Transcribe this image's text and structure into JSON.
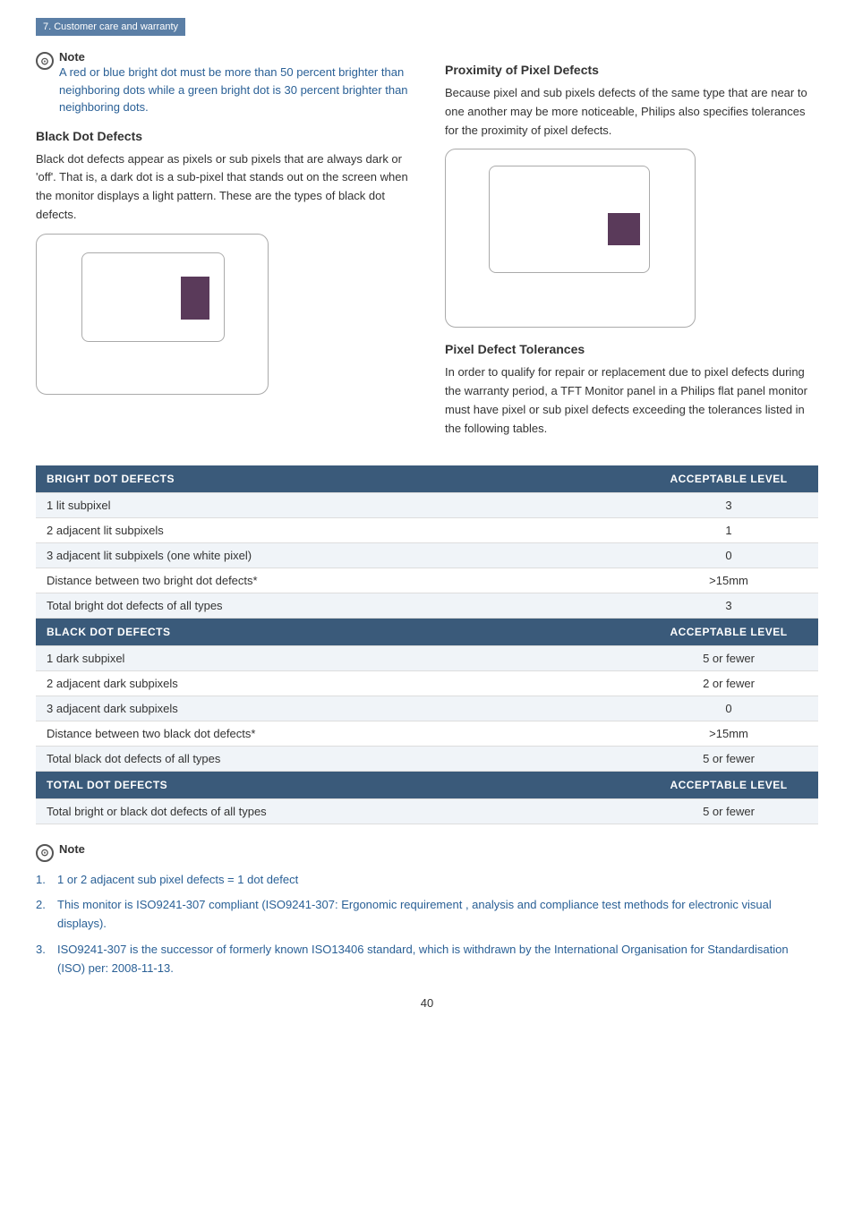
{
  "breadcrumb": {
    "text": "7. Customer care and warranty"
  },
  "note_top": {
    "label": "Note",
    "text": "A red or blue bright dot must be more than 50 percent brighter than neighboring dots while a green bright dot is 30 percent brighter than neighboring dots."
  },
  "black_dot": {
    "heading": "Black Dot Defects",
    "body": "Black dot defects appear as pixels or sub pixels that are always dark or 'off'. That is, a dark dot is a sub-pixel that stands out on the screen when the monitor displays a light pattern. These are the types of black dot defects."
  },
  "proximity": {
    "heading": "Proximity of Pixel Defects",
    "body": "Because pixel and sub pixels defects of the same type that are near to one another may be more noticeable, Philips also specifies tolerances for the proximity of pixel defects."
  },
  "pixel_tolerances": {
    "heading": "Pixel Defect Tolerances",
    "body": "In order to qualify for repair or replacement due to pixel defects during the warranty period, a TFT Monitor panel in a Philips flat panel monitor must have pixel or sub pixel defects exceeding the tolerances listed in the following tables."
  },
  "table": {
    "sections": [
      {
        "header_left": "BRIGHT DOT DEFECTS",
        "header_right": "ACCEPTABLE LEVEL",
        "rows": [
          {
            "left": "1 lit subpixel",
            "right": "3"
          },
          {
            "left": "2 adjacent lit subpixels",
            "right": "1"
          },
          {
            "left": "3 adjacent lit subpixels (one white pixel)",
            "right": "0"
          },
          {
            "left": "Distance between two bright dot defects*",
            "right": ">15mm"
          },
          {
            "left": "Total bright dot defects of all types",
            "right": "3"
          }
        ]
      },
      {
        "header_left": "BLACK DOT DEFECTS",
        "header_right": "ACCEPTABLE LEVEL",
        "rows": [
          {
            "left": "1 dark subpixel",
            "right": "5 or fewer"
          },
          {
            "left": "2 adjacent dark subpixels",
            "right": "2 or fewer"
          },
          {
            "left": "3 adjacent dark subpixels",
            "right": "0"
          },
          {
            "left": "Distance between two black dot defects*",
            "right": ">15mm"
          },
          {
            "left": "Total black dot defects of all types",
            "right": "5 or fewer"
          }
        ]
      },
      {
        "header_left": "TOTAL DOT DEFECTS",
        "header_right": "ACCEPTABLE LEVEL",
        "rows": [
          {
            "left": "Total bright or black dot defects of all types",
            "right": "5 or fewer"
          }
        ]
      }
    ]
  },
  "note_bottom": {
    "label": "Note",
    "items": [
      "1 or 2 adjacent sub pixel defects = 1 dot defect",
      "This monitor is ISO9241-307 compliant (ISO9241-307: Ergonomic requirement , analysis and compliance test methods for electronic visual displays).",
      "ISO9241-307 is the successor of formerly known ISO13406 standard, which is withdrawn by the International Organisation for Standardisation (ISO) per: 2008-11-13."
    ],
    "item_numbers": [
      "1.",
      "2.",
      "3."
    ]
  },
  "page_number": "40"
}
